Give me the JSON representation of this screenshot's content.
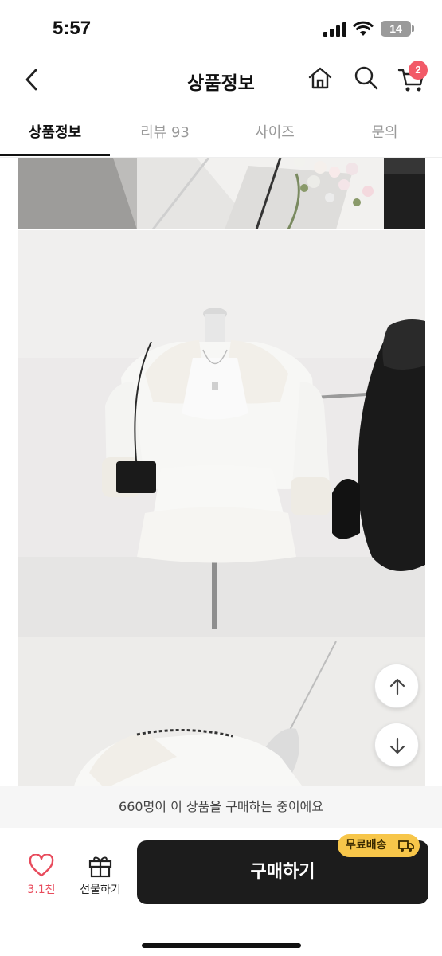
{
  "status_bar": {
    "time": "5:57",
    "battery": "14"
  },
  "header": {
    "title": "상품정보",
    "cart_count": "2"
  },
  "tabs": [
    {
      "label": "상품정보",
      "active": true
    },
    {
      "label": "리뷰 93",
      "active": false
    },
    {
      "label": "사이즈",
      "active": false
    },
    {
      "label": "문의",
      "active": false
    }
  ],
  "notice": "660명이 이 상품을 구매하는 중이에요",
  "bottom_bar": {
    "like_count": "3.1천",
    "gift_label": "선물하기",
    "buy_label": "구매하기",
    "shipping_badge": "무료배송"
  },
  "colors": {
    "accent_red": "#f25a68",
    "buy_button": "#1c1c1c",
    "shipping_badge": "#f7c64a"
  }
}
